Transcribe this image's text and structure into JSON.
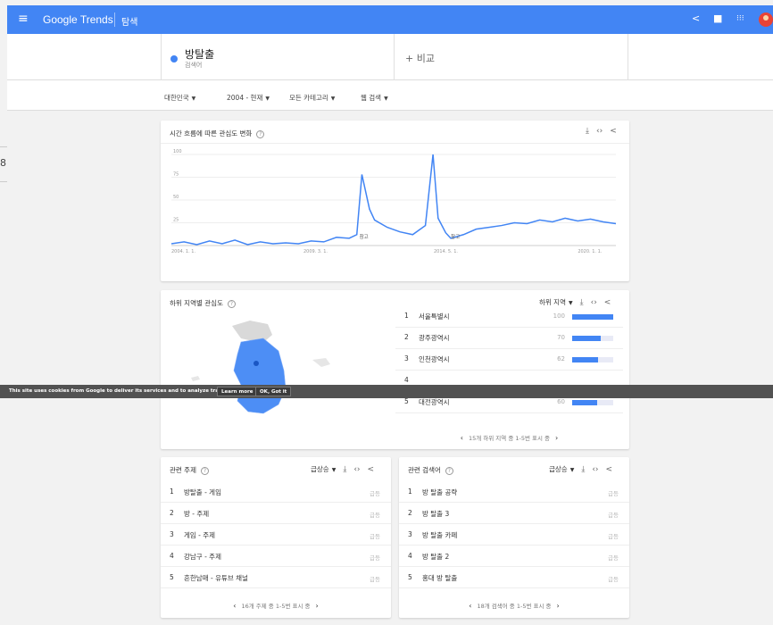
{
  "header": {
    "menu_icon": "hamburger-menu-icon",
    "brand": "Google Trends",
    "explore": "탐색",
    "icons": [
      "share-icon",
      "feedback-icon",
      "apps-grid-icon",
      "account-avatar"
    ]
  },
  "search": {
    "term": "방탈출",
    "term_sub": "검색어",
    "compare": "+ 비교",
    "term_color": "#4285f4"
  },
  "filters": {
    "region": "대한민국",
    "time": "2004 - 현재",
    "category": "모든 카테고리",
    "type": "웹 검색"
  },
  "edge_text": "8",
  "interest_over_time": {
    "title": "시간 흐름에 따른 관심도 변화",
    "notes": [
      "참고",
      "참고"
    ]
  },
  "chart_data": {
    "type": "line",
    "title": "시간 흐름에 따른 관심도 변화",
    "ylim": [
      0,
      100
    ],
    "yticks": [
      25,
      50,
      75,
      100
    ],
    "xtick_labels": [
      "2004. 1. 1.",
      "2009. 3. 1.",
      "2014. 5. 1.",
      "2020. 1. 1."
    ],
    "grid": true,
    "color": "#4285f4",
    "series": [
      {
        "x": [
          2004.0,
          2004.5,
          2005.0,
          2005.5,
          2006.0,
          2006.5,
          2007.0,
          2007.5,
          2008.0,
          2008.5,
          2009.0,
          2009.5,
          2010.0,
          2010.5,
          2011.0,
          2011.3,
          2011.5,
          2011.8,
          2012.0,
          2012.5,
          2013.0,
          2013.5,
          2014.0,
          2014.3,
          2014.5,
          2014.8,
          2015.0,
          2015.5,
          2016.0,
          2016.5,
          2017.0,
          2017.5,
          2018.0,
          2018.5,
          2019.0,
          2019.5,
          2020.0,
          2020.5,
          2021.0,
          2021.5
        ],
        "values": [
          2,
          4,
          1,
          5,
          2,
          6,
          1,
          4,
          2,
          3,
          2,
          5,
          4,
          9,
          8,
          12,
          78,
          40,
          28,
          20,
          15,
          12,
          22,
          100,
          30,
          14,
          8,
          12,
          18,
          20,
          22,
          25,
          24,
          28,
          26,
          30,
          27,
          29,
          26,
          24
        ]
      }
    ]
  },
  "regions": {
    "title": "하위 지역별 관심도",
    "dropdown": "하위 지역",
    "rows": [
      {
        "rank": "1",
        "name": "서울특별시",
        "value": "100",
        "pct": 1.0
      },
      {
        "rank": "2",
        "name": "광주광역시",
        "value": "70",
        "pct": 0.7
      },
      {
        "rank": "3",
        "name": "인천광역시",
        "value": "62",
        "pct": 0.62
      },
      {
        "rank": "4",
        "name": "",
        "value": "",
        "pct": 0
      },
      {
        "rank": "5",
        "name": "대전광역시",
        "value": "60",
        "pct": 0.6
      }
    ],
    "pager": "15개 하위 지역 중 1-5번 표시 중"
  },
  "cookie": {
    "message": "This site uses cookies from Google to deliver its services and to analyze traffic.",
    "learn_more": "Learn more",
    "ok": "OK, Got it"
  },
  "topics": {
    "title": "관련 주제",
    "dropdown": "급상승",
    "rows": [
      {
        "rank": "1",
        "name": "방탈출 - 게임",
        "status": "급등"
      },
      {
        "rank": "2",
        "name": "방 - 주제",
        "status": "급등"
      },
      {
        "rank": "3",
        "name": "게임 - 주제",
        "status": "급등"
      },
      {
        "rank": "4",
        "name": "강남구 - 주제",
        "status": "급등"
      },
      {
        "rank": "5",
        "name": "흔한남매 - 유튜브 채널",
        "status": "급등"
      }
    ],
    "pager": "16개 주제 중 1-5번 표시 중"
  },
  "queries": {
    "title": "관련 검색어",
    "dropdown": "급상승",
    "rows": [
      {
        "rank": "1",
        "name": "방 탈출 공략",
        "status": "급등"
      },
      {
        "rank": "2",
        "name": "방 탈출 3",
        "status": "급등"
      },
      {
        "rank": "3",
        "name": "방 탈출 카페",
        "status": "급등"
      },
      {
        "rank": "4",
        "name": "방 탈출 2",
        "status": "급등"
      },
      {
        "rank": "5",
        "name": "홍대 방 탈출",
        "status": "급등"
      }
    ],
    "pager": "18개 검색어 중 1-5번 표시 중"
  }
}
